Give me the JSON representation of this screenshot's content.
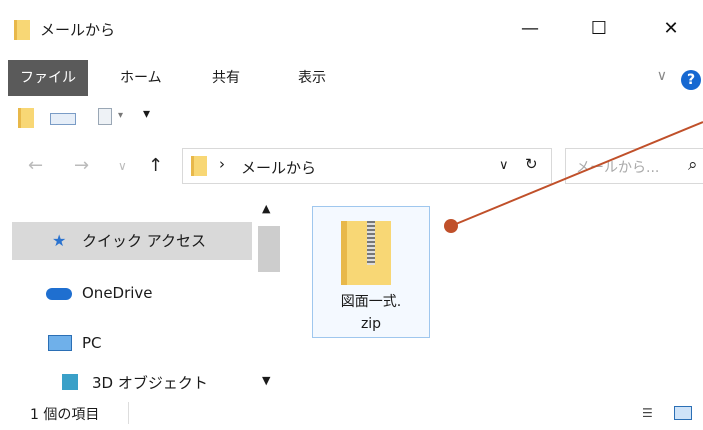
{
  "window": {
    "title": "メールから"
  },
  "window_controls": {
    "minimize": "—",
    "maximize": "☐",
    "close": "✕"
  },
  "ribbon": {
    "tabs": [
      "ファイル",
      "ホーム",
      "共有",
      "表示"
    ],
    "chevron": "∨",
    "help": "?"
  },
  "address": {
    "crumb_sep": "›",
    "path": "メールから",
    "dropdown": "∨",
    "refresh": "↻"
  },
  "search": {
    "placeholder": "メールから...",
    "icon": "⌕"
  },
  "nav": {
    "items": [
      {
        "label": "クイック アクセス",
        "icon": "star-icon"
      },
      {
        "label": "OneDrive",
        "icon": "cloud-icon"
      },
      {
        "label": "PC",
        "icon": "computer-icon"
      },
      {
        "label": "3D オブジェクト",
        "icon": "cube-icon"
      }
    ]
  },
  "file": {
    "name_line1": "図面一式.",
    "name_line2": "zip"
  },
  "status": {
    "text": "1 個の項目"
  },
  "colors": {
    "accent": "#1668d1",
    "annotation": "#c0502a",
    "folder": "#f8d775"
  }
}
